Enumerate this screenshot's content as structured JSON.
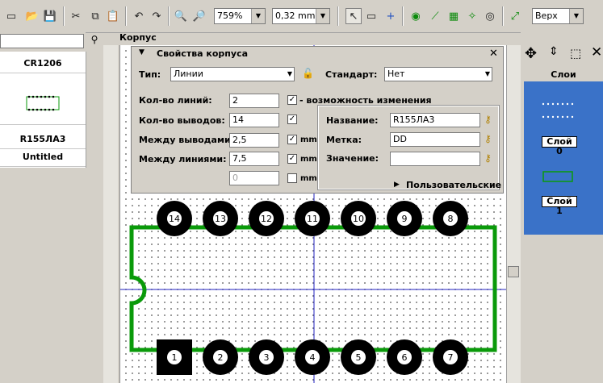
{
  "toolbar": {
    "zoom": "759%",
    "grid_step": "0,32 mm",
    "side": "Верх"
  },
  "left_panel": {
    "items": [
      "CR1206",
      "R155ЛА3",
      "Untitled"
    ]
  },
  "tab_title": "Корпус",
  "props": {
    "title": "Свойства корпуса",
    "type_label": "Тип:",
    "type_value": "Линии",
    "standard_label": "Стандарт:",
    "standard_value": "Нет",
    "lines_label": "Кол-во линий:",
    "lines_value": "2",
    "change_label": "- возможность изменения",
    "pins_label": "Кол-во выводов:",
    "pins_value": "14",
    "pin_pitch_label": "Между выводами:",
    "pin_pitch_value": "2,5",
    "line_pitch_label": "Между линиями:",
    "line_pitch_value": "7,5",
    "extra_value": "0",
    "unit": "mm",
    "name_label": "Название:",
    "name_value": "R155ЛА3",
    "mark_label": "Метка:",
    "mark_value": "DD",
    "value_label": "Значение:",
    "value_value": "",
    "custom_label": "Пользовательские"
  },
  "layers": {
    "header": "Слои",
    "items": [
      "Слой 0",
      "Слой 1"
    ]
  },
  "pins": {
    "top": [
      "14",
      "13",
      "12",
      "11",
      "10",
      "9",
      "8"
    ],
    "bottom": [
      "1",
      "2",
      "3",
      "4",
      "5",
      "6",
      "7"
    ]
  },
  "colors": {
    "outline": "#0a9a0a",
    "pad": "#000000",
    "crosshair": "#2020c0",
    "layer_bg": "#3a72c8"
  }
}
